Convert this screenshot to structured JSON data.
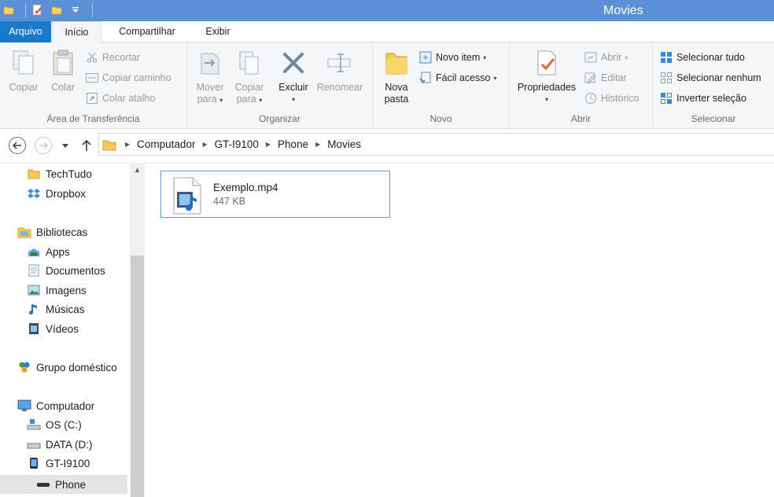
{
  "window": {
    "title": "Movies"
  },
  "tabs": [
    {
      "label": "Arquivo"
    },
    {
      "label": "Início"
    },
    {
      "label": "Compartilhar"
    },
    {
      "label": "Exibir"
    }
  ],
  "ribbon": {
    "clipboard": {
      "label": "Área de Transferência",
      "copy": "Copiar",
      "paste": "Colar",
      "cut": "Recortar",
      "copy_path": "Copiar caminho",
      "paste_shortcut": "Colar atalho"
    },
    "organize": {
      "label": "Organizar",
      "move_to": [
        "Mover",
        "para"
      ],
      "copy_to": [
        "Copiar",
        "para"
      ],
      "delete": "Excluir",
      "rename": "Renomear"
    },
    "new": {
      "label": "Novo",
      "new_folder": [
        "Nova",
        "pasta"
      ],
      "new_item": "Novo item",
      "easy_access": "Fácil acesso"
    },
    "open": {
      "label": "Abrir",
      "properties": "Propriedades",
      "open": "Abrir",
      "edit": "Editar",
      "history": "Histórico"
    },
    "select": {
      "label": "Selecionar",
      "select_all": "Selecionar tudo",
      "select_none": "Selecionar nenhum",
      "invert": "Inverter seleção"
    }
  },
  "breadcrumb": [
    "Computador",
    "GT-I9100",
    "Phone",
    "Movies"
  ],
  "navpane": {
    "items": [
      {
        "label": "TechTudo",
        "icon": "folder-icon"
      },
      {
        "label": "Dropbox",
        "icon": "dropbox-icon"
      },
      {
        "label": "Bibliotecas",
        "icon": "libraries-icon"
      },
      {
        "label": "Apps",
        "icon": "apps-icon"
      },
      {
        "label": "Documentos",
        "icon": "documents-icon"
      },
      {
        "label": "Imagens",
        "icon": "pictures-icon"
      },
      {
        "label": "Músicas",
        "icon": "music-icon"
      },
      {
        "label": "Vídeos",
        "icon": "videos-icon"
      },
      {
        "label": "Grupo doméstico",
        "icon": "homegroup-icon"
      },
      {
        "label": "Computador",
        "icon": "computer-icon"
      },
      {
        "label": "OS (C:)",
        "icon": "drive-icon"
      },
      {
        "label": "DATA (D:)",
        "icon": "drive-icon"
      },
      {
        "label": "GT-I9100",
        "icon": "phone-icon"
      },
      {
        "label": "Phone",
        "icon": "storage-icon"
      }
    ]
  },
  "content": {
    "files": [
      {
        "name": "Exemplo.mp4",
        "size": "447 KB",
        "icon": "video-file-icon"
      }
    ]
  },
  "colors": {
    "titlebar": "#5b8fd6",
    "file_tab": "#1979ca",
    "selection_border": "#5c9fe0",
    "ribbon_bg": "#f5f6f7"
  }
}
